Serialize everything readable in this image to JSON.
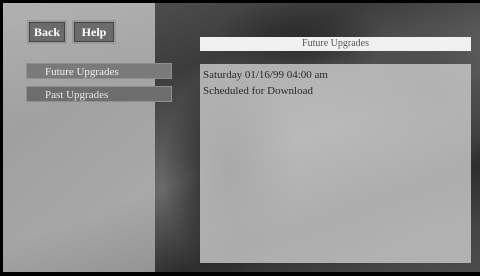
{
  "nav": {
    "back_label": "Back",
    "help_label": "Help"
  },
  "menu": {
    "items": [
      {
        "label": "Future Upgrades"
      },
      {
        "label": "Past Upgrades"
      }
    ]
  },
  "panel": {
    "title": "Future Upgrades",
    "entries": [
      {
        "text": "Saturday 01/16/99 04:00 am"
      },
      {
        "text": "Scheduled for Download"
      }
    ]
  },
  "colors": {
    "button_bg": "#6b6b6b",
    "menu_bg": "#6e6e6e",
    "title_bar_bg": "#f0f0f0",
    "content_bg": "#cdcdcd"
  }
}
